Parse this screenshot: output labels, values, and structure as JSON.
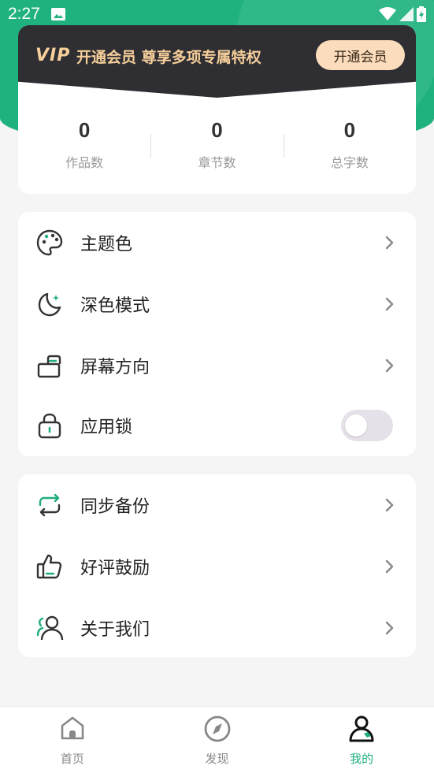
{
  "status_bar": {
    "time": "2:27"
  },
  "vip": {
    "logo": "VIP",
    "text": "开通会员 尊享多项专属特权",
    "button": "开通会员"
  },
  "stats": [
    {
      "value": "0",
      "label": "作品数"
    },
    {
      "value": "0",
      "label": "章节数"
    },
    {
      "value": "0",
      "label": "总字数"
    }
  ],
  "settings": [
    {
      "icon": "palette-icon",
      "label": "主题色"
    },
    {
      "icon": "moon-icon",
      "label": "深色模式"
    },
    {
      "icon": "screen-rotation-icon",
      "label": "屏幕方向"
    },
    {
      "icon": "lock-icon",
      "label": "应用锁",
      "toggle": false
    }
  ],
  "others": [
    {
      "icon": "sync-icon",
      "label": "同步备份"
    },
    {
      "icon": "thumbs-up-icon",
      "label": "好评鼓励"
    },
    {
      "icon": "about-icon",
      "label": "关于我们"
    }
  ],
  "bottom_nav": [
    {
      "icon": "home-icon",
      "label": "首页"
    },
    {
      "icon": "compass-icon",
      "label": "发现"
    },
    {
      "icon": "profile-icon",
      "label": "我的",
      "active": true
    }
  ],
  "colors": {
    "accent": "#1fae7b",
    "vip_dark": "#2f2e33",
    "vip_gold": "#f6cf9a"
  }
}
